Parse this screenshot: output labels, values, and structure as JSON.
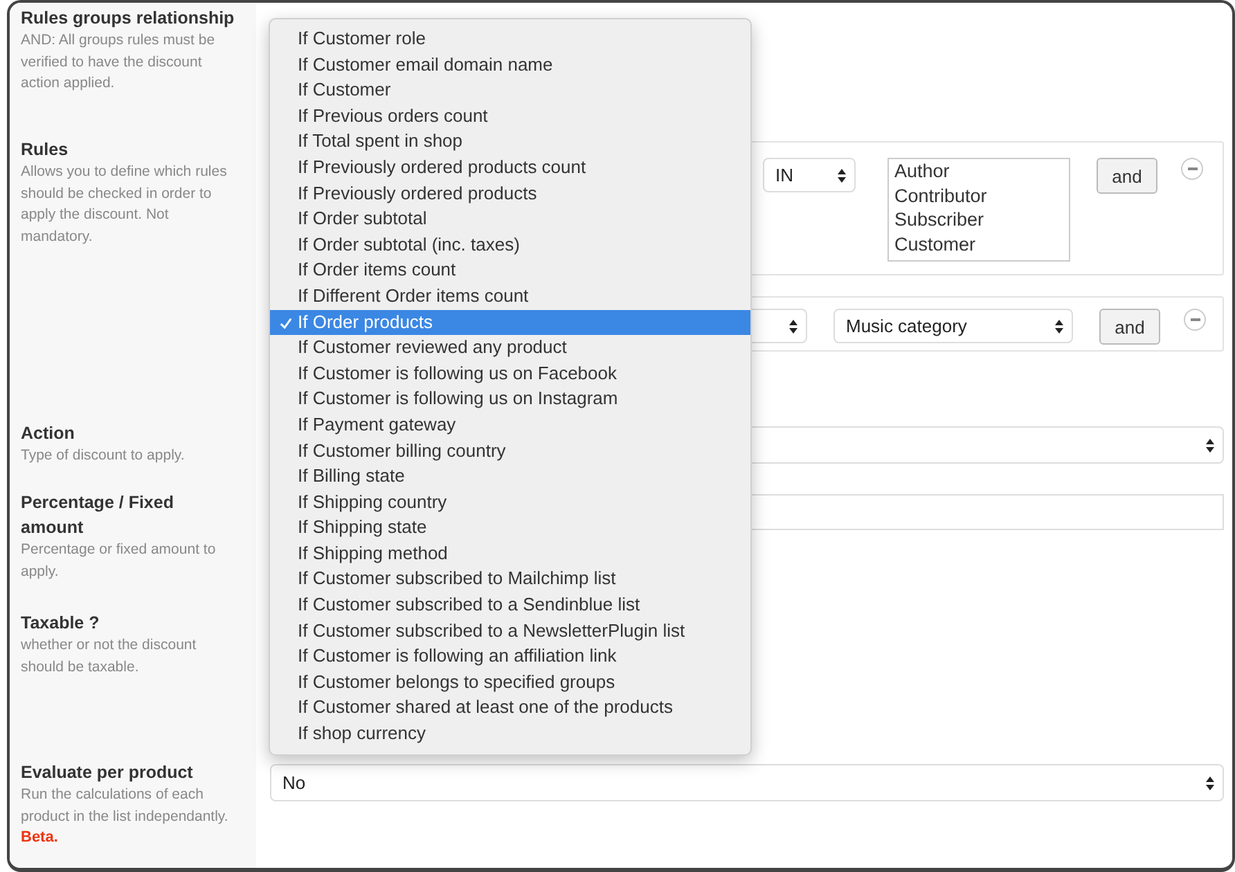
{
  "fields": [
    {
      "kind": "blank",
      "title": "Rules groups relationship",
      "help": "AND: All groups rules must be verified to have the discount action applied."
    },
    {
      "kind": "rules",
      "title": "Rules",
      "help": "Allows you to define which rules should be checked in order to apply the discount. Not mandatory."
    },
    {
      "kind": "select",
      "title": "Action",
      "help": "Type of discount to apply."
    },
    {
      "kind": "input",
      "title": "Percentage / Fixed amount",
      "help": "Percentage or fixed amount to apply."
    },
    {
      "kind": "blank",
      "title": "Taxable ?",
      "help": "whether or not the discount should be taxable."
    },
    {
      "kind": "select",
      "title": "Evaluate per product",
      "help": "Run the calculations of each product in the list independantly.",
      "value": "No",
      "note": "Beta."
    }
  ],
  "rule_groups": [
    {
      "operator": "IN",
      "options": [
        "Author",
        "Contributor",
        "Subscriber",
        "Customer"
      ],
      "button": "and"
    },
    {
      "value": "Music category",
      "button": "and"
    }
  ],
  "dropdown": [
    {
      "label": "If Customer role",
      "selected": false
    },
    {
      "label": "If Customer email domain name",
      "selected": false
    },
    {
      "label": "If Customer",
      "selected": false
    },
    {
      "label": "If Previous orders count",
      "selected": false
    },
    {
      "label": "If Total spent in shop",
      "selected": false
    },
    {
      "label": "If Previously ordered products count",
      "selected": false
    },
    {
      "label": "If Previously ordered products",
      "selected": false
    },
    {
      "label": "If Order subtotal",
      "selected": false
    },
    {
      "label": "If Order subtotal (inc. taxes)",
      "selected": false
    },
    {
      "label": "If Order items count",
      "selected": false
    },
    {
      "label": "If Different Order items count",
      "selected": false
    },
    {
      "label": "If Order products",
      "selected": true
    },
    {
      "label": "If Customer reviewed any product",
      "selected": false
    },
    {
      "label": "If Customer is following us on Facebook",
      "selected": false
    },
    {
      "label": "If Customer is following us on Instagram",
      "selected": false
    },
    {
      "label": "If Payment gateway",
      "selected": false
    },
    {
      "label": "If Customer billing country",
      "selected": false
    },
    {
      "label": "If Billing state",
      "selected": false
    },
    {
      "label": "If Shipping country",
      "selected": false
    },
    {
      "label": "If Shipping state",
      "selected": false
    },
    {
      "label": "If Shipping method",
      "selected": false
    },
    {
      "label": "If Customer subscribed to Mailchimp list",
      "selected": false
    },
    {
      "label": "If Customer subscribed to a Sendinblue list",
      "selected": false
    },
    {
      "label": "If Customer subscribed to a NewsletterPlugin list",
      "selected": false
    },
    {
      "label": "If Customer is following an affiliation link",
      "selected": false
    },
    {
      "label": "If Customer belongs to specified groups",
      "selected": false
    },
    {
      "label": "If Customer shared at least one of the products",
      "selected": false
    },
    {
      "label": "If shop currency",
      "selected": false
    }
  ]
}
